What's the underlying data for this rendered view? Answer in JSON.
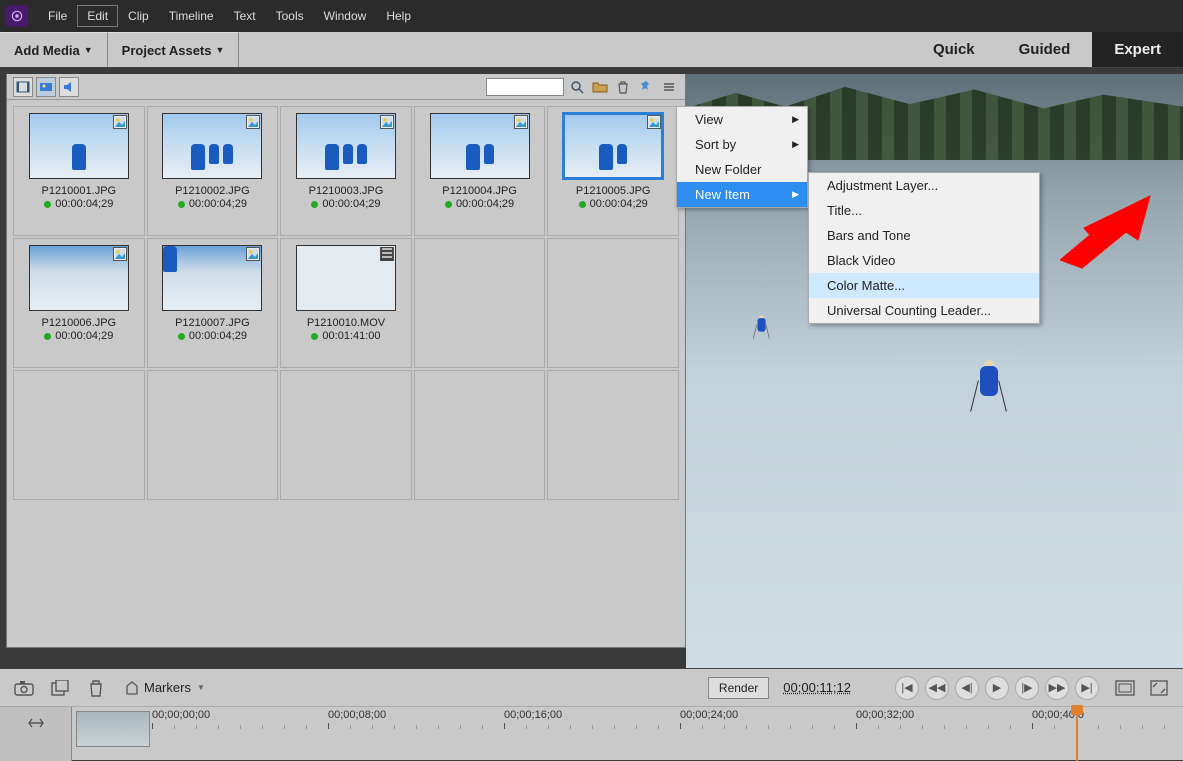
{
  "menubar": [
    "File",
    "Edit",
    "Clip",
    "Timeline",
    "Text",
    "Tools",
    "Window",
    "Help"
  ],
  "menubar_selected": 1,
  "secondbar": {
    "add_media": "Add Media",
    "project_assets": "Project Assets"
  },
  "modes": {
    "quick": "Quick",
    "guided": "Guided",
    "expert": "Expert",
    "active": "expert"
  },
  "assets_toolbar": {
    "view_film": "filmstrip-view",
    "view_thumb": "thumbnail-view",
    "view_audio": "audio-view",
    "search_placeholder": "",
    "icons": [
      "search-icon",
      "open-folder-icon",
      "trash-icon",
      "pin-icon",
      "panel-menu-icon"
    ]
  },
  "assets": [
    {
      "name": "P1210001.JPG",
      "dur": "00:00:04;29",
      "type": "img",
      "selected": false,
      "people": 1
    },
    {
      "name": "P1210002.JPG",
      "dur": "00:00:04;29",
      "type": "img",
      "selected": false,
      "people": 3
    },
    {
      "name": "P1210003.JPG",
      "dur": "00:00:04;29",
      "type": "img",
      "selected": false,
      "people": 3
    },
    {
      "name": "P1210004.JPG",
      "dur": "00:00:04;29",
      "type": "img",
      "selected": false,
      "people": 2
    },
    {
      "name": "P1210005.JPG",
      "dur": "00:00:04;29",
      "type": "img",
      "selected": true,
      "people": 2
    },
    {
      "name": "P1210006.JPG",
      "dur": "00:00:04;29",
      "type": "img",
      "selected": false,
      "variant": "cloud"
    },
    {
      "name": "P1210007.JPG",
      "dur": "00:00:04;29",
      "type": "img",
      "selected": false,
      "people": 1,
      "variant": "cloud"
    },
    {
      "name": "P1210010.MOV",
      "dur": "00:01:41:00",
      "type": "mov",
      "selected": false,
      "variant": "snow"
    }
  ],
  "contextmenu": {
    "items": [
      "View",
      "Sort by",
      "New Folder",
      "New Item"
    ],
    "highlighted": 3,
    "submenu_parent": "New Item",
    "submenu": [
      "Adjustment Layer...",
      "Title...",
      "Bars and Tone",
      "Black Video",
      "Color Matte...",
      "Universal Counting Leader..."
    ],
    "submenu_highlighted": 4
  },
  "bottombar": {
    "markers_label": "Markers",
    "render_label": "Render",
    "timecode": "00;00;11;12",
    "ticks": [
      "00;00;00;00",
      "00;00;08;00",
      "00;00;16;00",
      "00;00;24;00",
      "00;00;32;00",
      "00;00;40;0"
    ]
  }
}
